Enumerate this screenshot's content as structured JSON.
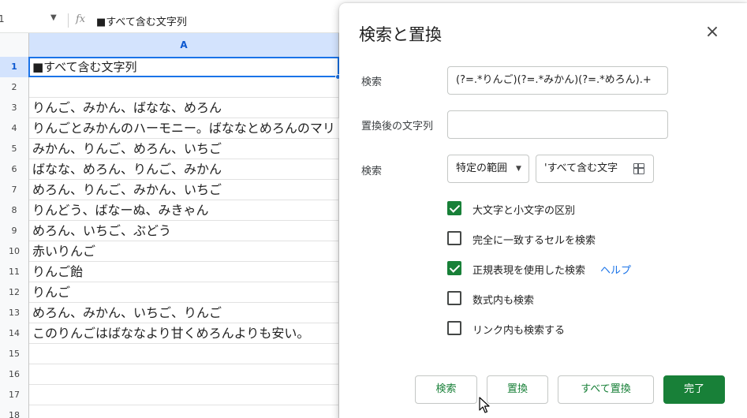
{
  "formula_bar": {
    "name_box": "1",
    "fx_label": "fx",
    "content": "■すべて含む文字列"
  },
  "sheet": {
    "column_header": "A",
    "rows": [
      {
        "num": "1",
        "value": "■すべて含む文字列"
      },
      {
        "num": "2",
        "value": ""
      },
      {
        "num": "3",
        "value": "りんご、みかん、ばなな、めろん"
      },
      {
        "num": "4",
        "value": "りんごとみかんのハーモニー。ばななとめろんのマリ"
      },
      {
        "num": "5",
        "value": "みかん、りんご、めろん、いちご"
      },
      {
        "num": "6",
        "value": "ばなな、めろん、りんご、みかん"
      },
      {
        "num": "7",
        "value": "めろん、りんご、みかん、いちご"
      },
      {
        "num": "8",
        "value": "りんどう、ばなーぬ、みきゃん"
      },
      {
        "num": "9",
        "value": "めろん、いちご、ぶどう"
      },
      {
        "num": "10",
        "value": "赤いりんご"
      },
      {
        "num": "11",
        "value": "りんご飴"
      },
      {
        "num": "12",
        "value": "りんご"
      },
      {
        "num": "13",
        "value": "めろん、みかん、いちご、りんご"
      },
      {
        "num": "14",
        "value": "このりんごはばななより甘くめろんよりも安い。"
      },
      {
        "num": "15",
        "value": ""
      },
      {
        "num": "16",
        "value": ""
      },
      {
        "num": "17",
        "value": ""
      },
      {
        "num": "18",
        "value": ""
      }
    ]
  },
  "dialog": {
    "title": "検索と置換",
    "close_icon": "close-icon",
    "search_label": "検索",
    "search_value": "(?=.*りんご)(?=.*みかん)(?=.*めろん).+",
    "replace_label": "置換後の文字列",
    "replace_value": "",
    "scope_label": "検索",
    "scope_select": "特定の範囲",
    "range_value": "'すべて含む文字",
    "checkboxes": [
      {
        "label": "大文字と小文字の区別",
        "checked": true
      },
      {
        "label": "完全に一致するセルを検索",
        "checked": false
      },
      {
        "label": "正規表現を使用した検索",
        "checked": true
      },
      {
        "label": "数式内も検索",
        "checked": false
      },
      {
        "label": "リンク内も検索する",
        "checked": false
      }
    ],
    "help_link": "ヘルプ",
    "buttons": {
      "find": "検索",
      "replace": "置換",
      "replace_all": "すべて置換",
      "done": "完了"
    },
    "accent_color": "#188038"
  }
}
